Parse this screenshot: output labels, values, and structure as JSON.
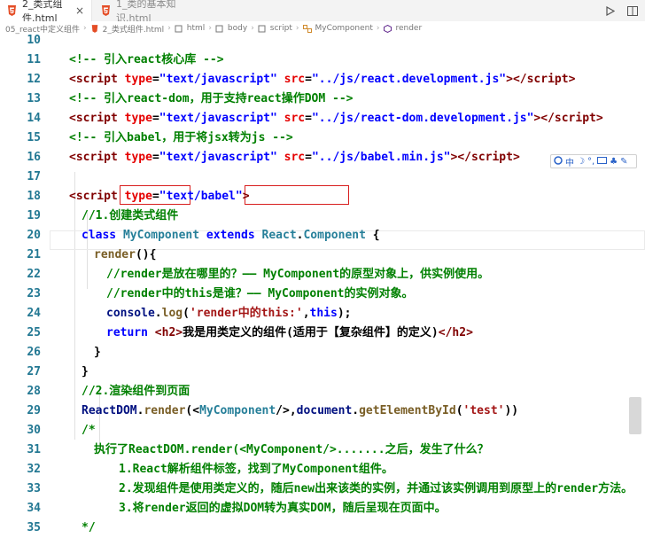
{
  "tabs": [
    {
      "label": "2_类式组件.html",
      "active": true
    },
    {
      "label": "1_类的基本知识.html",
      "active": false
    }
  ],
  "breadcrumb": [
    "05_react中定义组件",
    "2_类式组件.html",
    "html",
    "body",
    "script",
    "MyComponent",
    "render"
  ],
  "lines": [
    {
      "n": "10",
      "indent": 0,
      "tokens": []
    },
    {
      "n": "11",
      "indent": 0,
      "tokens": [
        {
          "t": "<!-- 引入react核心库 -->",
          "c": "cm"
        }
      ]
    },
    {
      "n": "12",
      "indent": 0,
      "tokens": [
        {
          "t": "<",
          "c": "tag"
        },
        {
          "t": "script",
          "c": "tag"
        },
        {
          "t": " ",
          "c": "plain"
        },
        {
          "t": "type",
          "c": "attr"
        },
        {
          "t": "=",
          "c": "plain"
        },
        {
          "t": "\"text/javascript\"",
          "c": "str"
        },
        {
          "t": " ",
          "c": "plain"
        },
        {
          "t": "src",
          "c": "attr"
        },
        {
          "t": "=",
          "c": "plain"
        },
        {
          "t": "\"../js/react.development.js\"",
          "c": "str"
        },
        {
          "t": "></",
          "c": "tag"
        },
        {
          "t": "script",
          "c": "tag"
        },
        {
          "t": ">",
          "c": "tag"
        }
      ]
    },
    {
      "n": "13",
      "indent": 0,
      "tokens": [
        {
          "t": "<!-- 引入react-dom，用于支持react操作DOM -->",
          "c": "cm"
        }
      ]
    },
    {
      "n": "14",
      "indent": 0,
      "tokens": [
        {
          "t": "<",
          "c": "tag"
        },
        {
          "t": "script",
          "c": "tag"
        },
        {
          "t": " ",
          "c": "plain"
        },
        {
          "t": "type",
          "c": "attr"
        },
        {
          "t": "=",
          "c": "plain"
        },
        {
          "t": "\"text/javascript\"",
          "c": "str"
        },
        {
          "t": " ",
          "c": "plain"
        },
        {
          "t": "src",
          "c": "attr"
        },
        {
          "t": "=",
          "c": "plain"
        },
        {
          "t": "\"../js/react-dom.development.js\"",
          "c": "str"
        },
        {
          "t": "></",
          "c": "tag"
        },
        {
          "t": "script",
          "c": "tag"
        },
        {
          "t": ">",
          "c": "tag"
        }
      ]
    },
    {
      "n": "15",
      "indent": 0,
      "tokens": [
        {
          "t": "<!-- 引入babel，用于将jsx转为js -->",
          "c": "cm"
        }
      ]
    },
    {
      "n": "16",
      "indent": 0,
      "tokens": [
        {
          "t": "<",
          "c": "tag"
        },
        {
          "t": "script",
          "c": "tag"
        },
        {
          "t": " ",
          "c": "plain"
        },
        {
          "t": "type",
          "c": "attr"
        },
        {
          "t": "=",
          "c": "plain"
        },
        {
          "t": "\"text/javascript\"",
          "c": "str"
        },
        {
          "t": " ",
          "c": "plain"
        },
        {
          "t": "src",
          "c": "attr"
        },
        {
          "t": "=",
          "c": "plain"
        },
        {
          "t": "\"../js/babel.min.js\"",
          "c": "str"
        },
        {
          "t": "></",
          "c": "tag"
        },
        {
          "t": "script",
          "c": "tag"
        },
        {
          "t": ">",
          "c": "tag"
        }
      ]
    },
    {
      "n": "17",
      "indent": 0,
      "tokens": []
    },
    {
      "n": "18",
      "indent": 0,
      "tokens": [
        {
          "t": "<",
          "c": "tag"
        },
        {
          "t": "script",
          "c": "tag"
        },
        {
          "t": " ",
          "c": "plain"
        },
        {
          "t": "type",
          "c": "attr"
        },
        {
          "t": "=",
          "c": "plain"
        },
        {
          "t": "\"text/babel\"",
          "c": "str"
        },
        {
          "t": ">",
          "c": "tag"
        }
      ]
    },
    {
      "n": "19",
      "indent": 1,
      "tokens": [
        {
          "t": "//1.创建类式组件",
          "c": "cm"
        }
      ]
    },
    {
      "n": "20",
      "indent": 1,
      "tokens": [
        {
          "t": "class",
          "c": "kw"
        },
        {
          "t": " ",
          "c": "plain"
        },
        {
          "t": "MyComponent",
          "c": "cls"
        },
        {
          "t": " ",
          "c": "plain"
        },
        {
          "t": "extends",
          "c": "kw"
        },
        {
          "t": " ",
          "c": "plain"
        },
        {
          "t": "React",
          "c": "cls"
        },
        {
          "t": ".",
          "c": "plain"
        },
        {
          "t": "Component",
          "c": "cls"
        },
        {
          "t": " {",
          "c": "plain"
        }
      ]
    },
    {
      "n": "21",
      "indent": 2,
      "tokens": [
        {
          "t": "render",
          "c": "fn"
        },
        {
          "t": "(){",
          "c": "plain"
        }
      ]
    },
    {
      "n": "22",
      "indent": 3,
      "tokens": [
        {
          "t": "//render是放在哪里的？—— MyComponent的原型对象上，供实例使用。",
          "c": "cm"
        }
      ]
    },
    {
      "n": "23",
      "indent": 3,
      "tokens": [
        {
          "t": "//render中的this是谁？—— MyComponent的实例对象。",
          "c": "cm"
        }
      ]
    },
    {
      "n": "24",
      "indent": 3,
      "tokens": [
        {
          "t": "console",
          "c": "ident"
        },
        {
          "t": ".",
          "c": "plain"
        },
        {
          "t": "log",
          "c": "fn"
        },
        {
          "t": "(",
          "c": "plain"
        },
        {
          "t": "'render中的this:'",
          "c": "strv"
        },
        {
          "t": ",",
          "c": "plain"
        },
        {
          "t": "this",
          "c": "kw"
        },
        {
          "t": ");",
          "c": "plain"
        }
      ]
    },
    {
      "n": "25",
      "indent": 3,
      "tokens": [
        {
          "t": "return",
          "c": "kw"
        },
        {
          "t": " ",
          "c": "plain"
        },
        {
          "t": "<h2>",
          "c": "tag"
        },
        {
          "t": "我是用类定义的组件(适用于【复杂组件】的定义)",
          "c": "plain"
        },
        {
          "t": "</h2>",
          "c": "tag"
        }
      ]
    },
    {
      "n": "26",
      "indent": 2,
      "tokens": [
        {
          "t": "}",
          "c": "plain"
        }
      ]
    },
    {
      "n": "27",
      "indent": 1,
      "tokens": [
        {
          "t": "}",
          "c": "plain"
        }
      ]
    },
    {
      "n": "28",
      "indent": 1,
      "tokens": [
        {
          "t": "//2.渲染组件到页面",
          "c": "cm"
        }
      ]
    },
    {
      "n": "29",
      "indent": 1,
      "tokens": [
        {
          "t": "ReactDOM",
          "c": "ident"
        },
        {
          "t": ".",
          "c": "plain"
        },
        {
          "t": "render",
          "c": "fn"
        },
        {
          "t": "(<",
          "c": "plain"
        },
        {
          "t": "MyComponent",
          "c": "cls"
        },
        {
          "t": "/>,",
          "c": "plain"
        },
        {
          "t": "document",
          "c": "ident"
        },
        {
          "t": ".",
          "c": "plain"
        },
        {
          "t": "getElementById",
          "c": "fn"
        },
        {
          "t": "(",
          "c": "plain"
        },
        {
          "t": "'test'",
          "c": "strv"
        },
        {
          "t": "))",
          "c": "plain"
        }
      ]
    },
    {
      "n": "30",
      "indent": 1,
      "tokens": [
        {
          "t": "/*",
          "c": "cm"
        }
      ]
    },
    {
      "n": "31",
      "indent": 2,
      "tokens": [
        {
          "t": "执行了ReactDOM.render(<MyComponent/>.......之后，发生了什么？",
          "c": "cm"
        }
      ]
    },
    {
      "n": "32",
      "indent": 4,
      "tokens": [
        {
          "t": "1.React解析组件标签，找到了MyComponent组件。",
          "c": "cm"
        }
      ]
    },
    {
      "n": "33",
      "indent": 4,
      "tokens": [
        {
          "t": "2.发现组件是使用类定义的，随后new出来该类的实例，并通过该实例调用到原型上的render方法。",
          "c": "cm"
        }
      ]
    },
    {
      "n": "34",
      "indent": 4,
      "tokens": [
        {
          "t": "3.将render返回的虚拟DOM转为真实DOM，随后呈现在页面中。",
          "c": "cm"
        }
      ]
    },
    {
      "n": "35",
      "indent": 1,
      "tokens": [
        {
          "t": "*/",
          "c": "cm"
        }
      ]
    }
  ],
  "ime_toolbar": {
    "label": "中"
  },
  "colors": {
    "comment": "#008000",
    "tag": "#800000",
    "attribute": "#e50000",
    "string": "#0000ff",
    "keyword": "#0000ff",
    "class": "#267f99",
    "highlight_box": "#d81e1e",
    "line_number": "#237893"
  }
}
